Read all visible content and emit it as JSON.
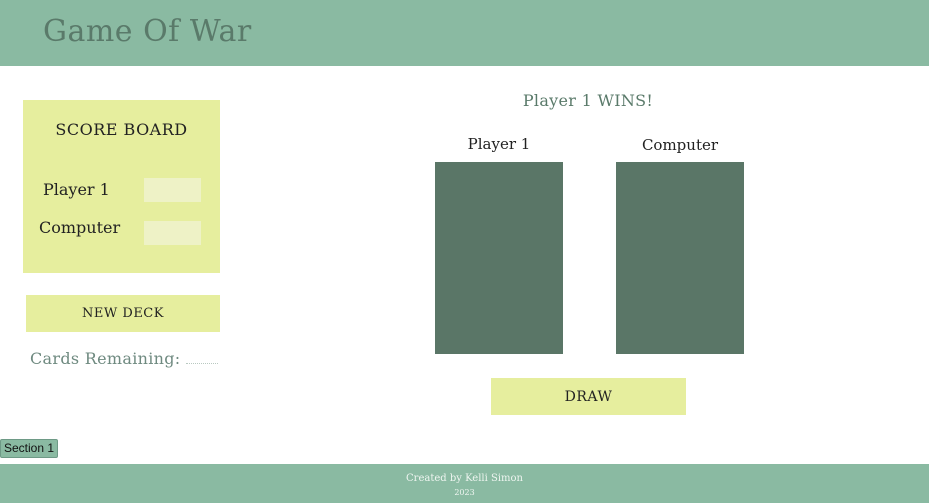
{
  "header": {
    "title": "Game Of War"
  },
  "scoreboard": {
    "title": "SCORE BOARD",
    "player_label": "Player 1",
    "computer_label": "Computer",
    "player_score": "",
    "computer_score": ""
  },
  "controls": {
    "new_deck_label": "NEW DECK",
    "draw_label": "DRAW",
    "cards_remaining_label": "Cards Remaining:",
    "cards_remaining_value": ""
  },
  "game": {
    "result": "Player 1 WINS!",
    "player_label": "Player 1",
    "computer_label": "Computer"
  },
  "section_tag": "Section 1",
  "footer": {
    "credit": "Created by Kelli Simon",
    "year": "2023"
  },
  "colors": {
    "header_bg": "#8abaa2",
    "panel_bg": "#e6ee9e",
    "card_bg": "#5a7667",
    "title_text": "#5a7a6a"
  }
}
